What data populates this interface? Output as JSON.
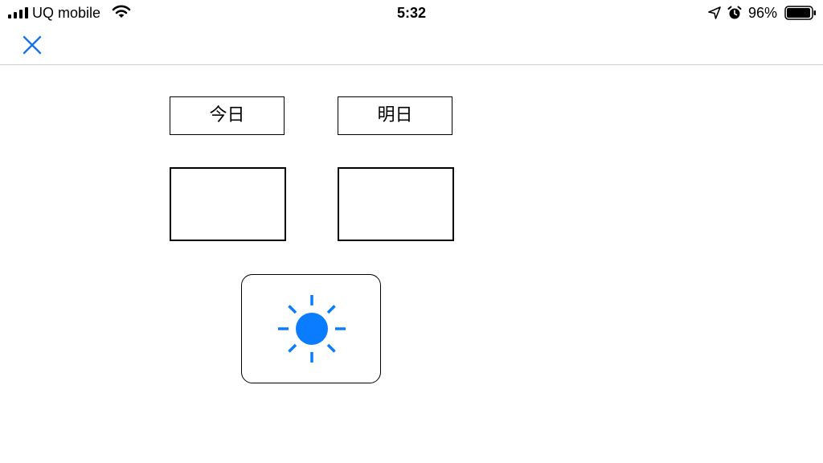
{
  "status_bar": {
    "carrier": "UQ mobile",
    "time": "5:32",
    "battery_percent": "96%",
    "icons": [
      "signal-icon",
      "wifi-icon",
      "location-icon",
      "alarm-icon",
      "battery-icon"
    ]
  },
  "nav": {
    "close_icon": "close-icon"
  },
  "days": {
    "today_label": "今日",
    "tomorrow_label": "明日"
  },
  "weather_button": {
    "icon": "sun-icon"
  },
  "colors": {
    "accent": "#1a73e8",
    "sun": "#0a7cff",
    "border": "#000000",
    "divider": "#cfcfcf"
  }
}
